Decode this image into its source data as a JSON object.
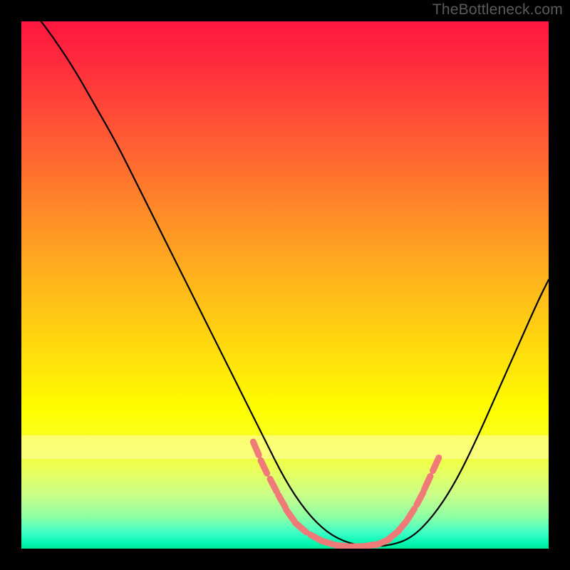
{
  "watermark": "TheBottleneck.com",
  "chart_data": {
    "type": "line",
    "title": "",
    "xlabel": "",
    "ylabel": "",
    "xlim": [
      0,
      100
    ],
    "ylim": [
      0,
      100
    ],
    "grid": false,
    "legend": false,
    "series": [
      {
        "name": "main-curve",
        "color": "#000000",
        "x": [
          0,
          3,
          6,
          10,
          14,
          18,
          22,
          26,
          30,
          34,
          38,
          42,
          46,
          50,
          54,
          58,
          62,
          66,
          70,
          74,
          78,
          82,
          86,
          90,
          94,
          98,
          100
        ],
        "y": [
          104,
          101,
          97,
          91,
          84,
          77,
          69,
          61,
          53,
          45,
          37,
          29,
          21,
          13,
          7,
          3,
          1,
          0.4,
          0.6,
          2,
          6,
          12,
          20,
          29,
          38,
          47,
          51
        ]
      },
      {
        "name": "highlight-segment",
        "type": "scatter",
        "color": "#ef7a78",
        "marker": "dash",
        "note": "points along the curve rendered as short rounded dashes",
        "x": [
          44.5,
          46.0,
          47.8,
          49.4,
          51.0,
          53.0,
          56.0,
          58.5,
          61.0,
          63.5,
          66.0,
          68.5,
          70.5,
          72.2,
          73.8,
          75.6,
          77.0,
          78.6
        ],
        "y": [
          19.0,
          15.5,
          12.0,
          9.0,
          6.3,
          4.0,
          2.0,
          1.0,
          0.5,
          0.4,
          0.6,
          1.2,
          2.5,
          4.2,
          6.4,
          9.5,
          12.5,
          16.0
        ]
      }
    ],
    "background_gradient": {
      "direction": "top-to-bottom",
      "stops": [
        {
          "pos": 0.0,
          "color": "#ff163f"
        },
        {
          "pos": 0.22,
          "color": "#ff5a34"
        },
        {
          "pos": 0.5,
          "color": "#ffb71b"
        },
        {
          "pos": 0.74,
          "color": "#ffff00"
        },
        {
          "pos": 0.9,
          "color": "#c8ff8a"
        },
        {
          "pos": 1.0,
          "color": "#00e89a"
        }
      ]
    }
  }
}
